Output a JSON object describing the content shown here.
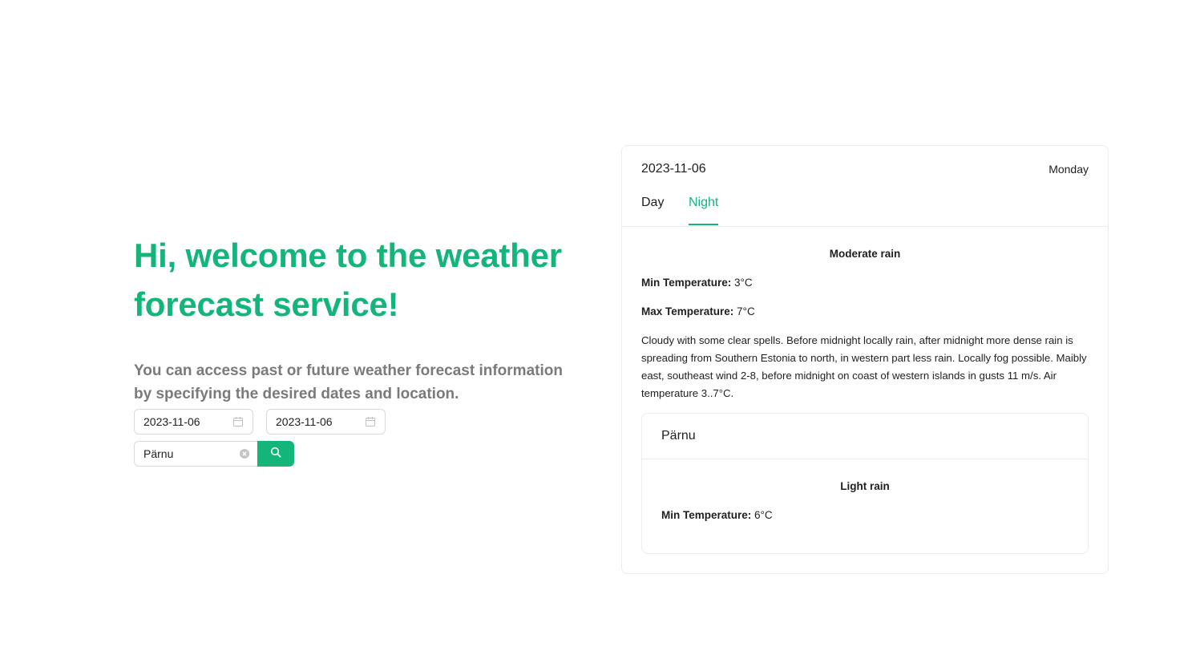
{
  "hero": {
    "title": "Hi, welcome to the weather forecast service!",
    "subtitle": "You can access past or future weather forecast information by specifying the desired dates and location."
  },
  "filters": {
    "start_date": "2023-11-06",
    "end_date": "2023-11-06",
    "location": "Pärnu"
  },
  "forecast": {
    "date": "2023-11-06",
    "weekday": "Monday",
    "tabs": [
      "Day",
      "Night"
    ],
    "active_tab": "Night",
    "condition": "Moderate rain",
    "min_label": "Min Temperature:",
    "min_value": " 3°C",
    "max_label": "Max Temperature:",
    "max_value": " 7°C",
    "description": "Cloudy with some clear spells. Before midnight locally rain, after midnight more dense rain is spreading from Southern Estonia to north, in western part less rain. Locally fog possible. Maibly east, southeast wind 2-8, before midnight on coast of western islands in gusts 11 m/s. Air temperature 3..7°C.",
    "place": {
      "name": "Pärnu",
      "condition": "Light rain",
      "min_label": "Min Temperature:",
      "min_value": " 6°C"
    }
  },
  "colors": {
    "accent": "#13b57a",
    "muted_text": "#7a7a7a",
    "border": "#d9d9d9"
  },
  "icons": {
    "date_picker": "calendar-icon",
    "clear": "clear-circle-icon",
    "search": "search-icon"
  }
}
